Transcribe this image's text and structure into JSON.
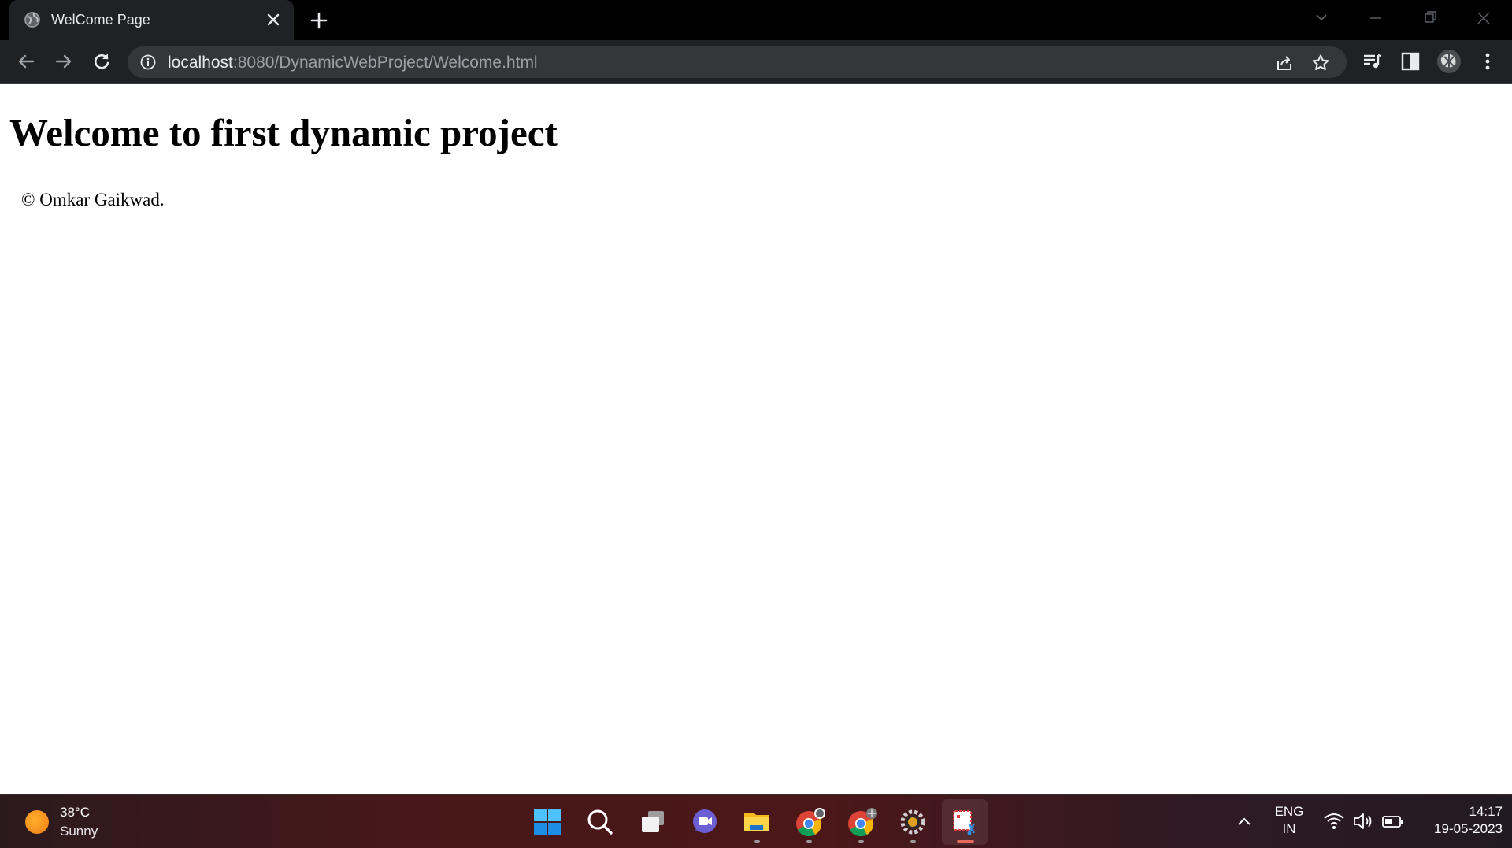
{
  "browser": {
    "tab": {
      "title": "WelCome Page",
      "favicon": "globe-icon"
    },
    "address_bar": {
      "host": "localhost",
      "rest": ":8080/DynamicWebProject/Welcome.html"
    }
  },
  "page": {
    "heading": "Welcome to first dynamic project",
    "footer": "© Omkar Gaikwad."
  },
  "taskbar": {
    "weather": {
      "temperature": "38°C",
      "condition": "Sunny"
    },
    "apps": [
      "start-icon",
      "search-icon",
      "task-view-icon",
      "chat-icon",
      "file-explorer-icon",
      "chrome-icon",
      "chrome-icon",
      "settings-icon",
      "snipping-tool-icon"
    ],
    "language": {
      "line1": "ENG",
      "line2": "IN"
    },
    "clock": {
      "time": "14:17",
      "date": "19-05-2023"
    }
  },
  "colors": {
    "tabstrip": "#000000",
    "toolbar": "#202124",
    "omnibox": "#35363a",
    "snip_indicator": "#e86a5a"
  }
}
